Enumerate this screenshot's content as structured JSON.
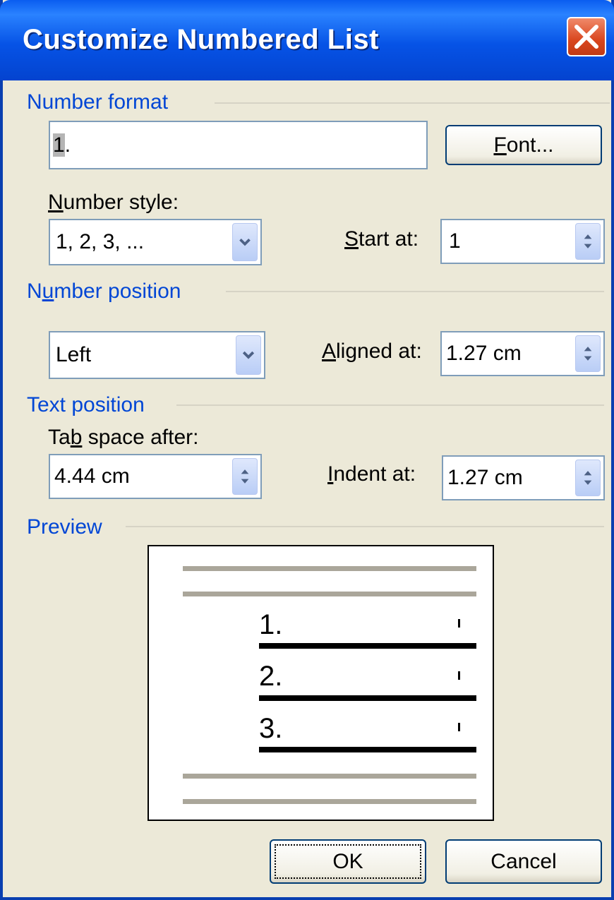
{
  "dialog": {
    "title": "Customize Numbered List",
    "accent_color": "#0046d5",
    "close_icon": "close-icon"
  },
  "number_format": {
    "group_label": "Number format",
    "format_value_highlight": "1",
    "format_value_rest": ".",
    "font_button_label_u": "F",
    "font_button_label_rest": "ont..."
  },
  "number_style": {
    "label_u": "N",
    "label_rest": "umber style:",
    "selected": "1, 2, 3, ...",
    "start_at_label_u": "S",
    "start_at_label_rest": "tart at:",
    "start_at_value": "1"
  },
  "number_position": {
    "group_label_pre": "N",
    "group_label_u": "u",
    "group_label_rest": "mber position",
    "alignment_selected": "Left",
    "aligned_at_label_u": "A",
    "aligned_at_label_rest": "ligned at:",
    "aligned_at_value": "1.27 cm"
  },
  "text_position": {
    "group_label": "Text position",
    "tab_space_label_pre": "Ta",
    "tab_space_label_u": "b",
    "tab_space_label_rest": " space after:",
    "tab_space_value": "4.44 cm",
    "indent_label_u": "I",
    "indent_label_rest": "ndent at:",
    "indent_value": "1.27 cm"
  },
  "preview": {
    "group_label": "Preview",
    "items": [
      "1.",
      "2.",
      "3."
    ]
  },
  "buttons": {
    "ok": "OK",
    "cancel": "Cancel"
  }
}
